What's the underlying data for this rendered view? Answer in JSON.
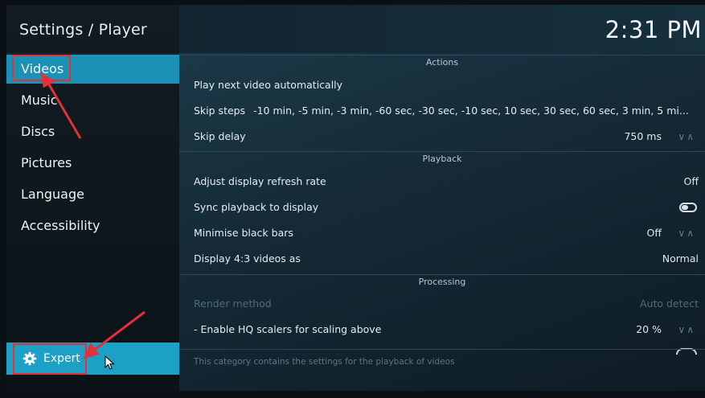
{
  "header": {
    "title": "Settings / Player",
    "clock": "2:31 PM"
  },
  "sidebar": {
    "items": [
      {
        "label": "Videos"
      },
      {
        "label": "Music"
      },
      {
        "label": "Discs"
      },
      {
        "label": "Pictures"
      },
      {
        "label": "Language"
      },
      {
        "label": "Accessibility"
      }
    ],
    "expert_label": "Expert"
  },
  "sections": {
    "actions": "Actions",
    "playback": "Playback",
    "processing": "Processing"
  },
  "rows": {
    "play_next": {
      "label": "Play next video automatically"
    },
    "skip_steps": {
      "label": "Skip steps",
      "value": "-10 min, -5 min, -3 min, -60 sec, -30 sec, -10 sec, 10 sec, 30 sec, 60 sec, 3 min, 5 mi..."
    },
    "skip_delay": {
      "label": "Skip delay",
      "value": "750 ms"
    },
    "refresh_rate": {
      "label": "Adjust display refresh rate",
      "value": "Off"
    },
    "sync_playback": {
      "label": "Sync playback to display"
    },
    "black_bars": {
      "label": "Minimise black bars",
      "value": "Off"
    },
    "display_43": {
      "label": "Display 4:3 videos as",
      "value": "Normal"
    },
    "render_method": {
      "label": "Render method",
      "value": "Auto detect"
    },
    "hq_scalers": {
      "label": "- Enable HQ scalers for scaling above",
      "value": "20 %"
    }
  },
  "footer": "This category contains the settings for the playback of videos",
  "colors": {
    "accent": "#1da0c6",
    "annotation": "#e2313b"
  },
  "icons": {
    "expert": "gear-icon",
    "cursor": "mouse-pointer-icon"
  }
}
